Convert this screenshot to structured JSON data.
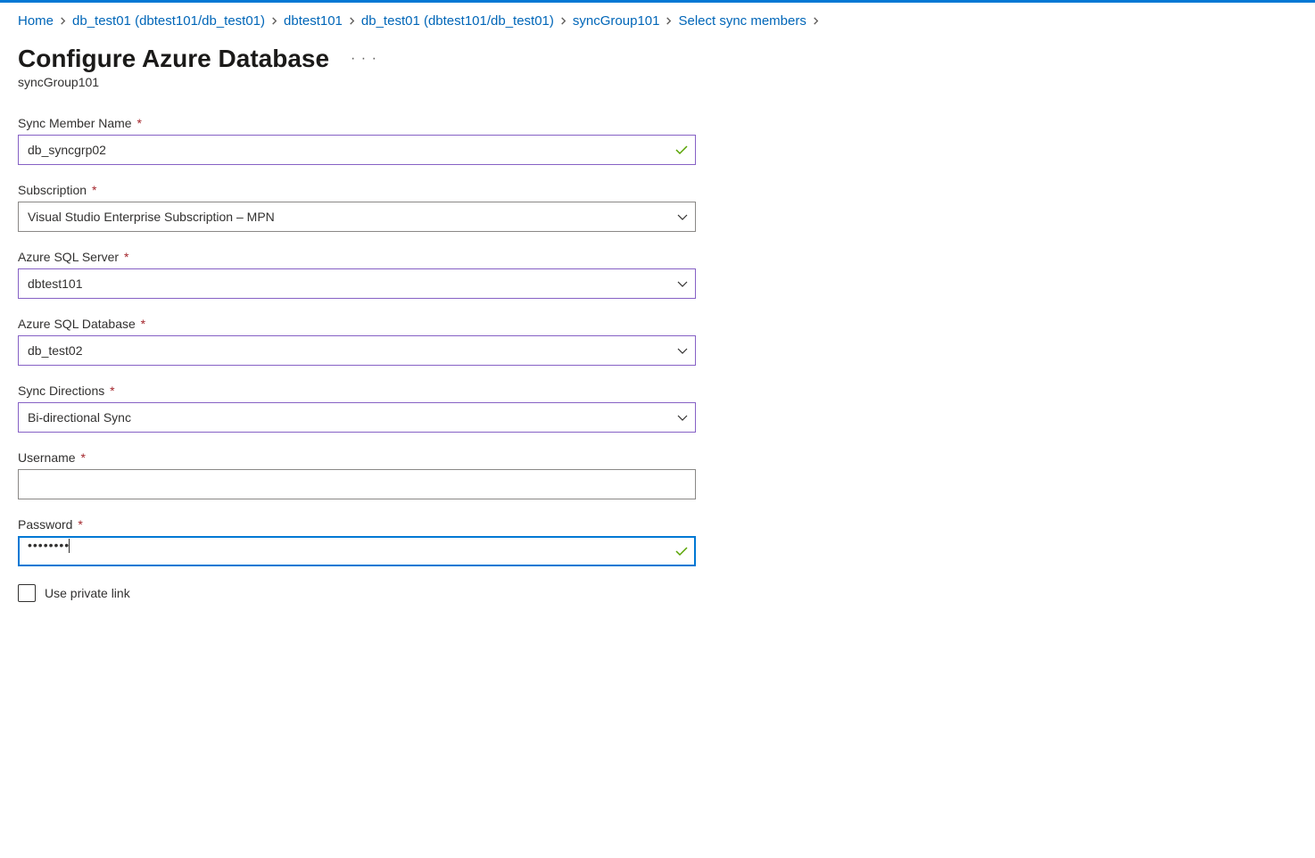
{
  "breadcrumb": {
    "items": [
      "Home",
      "db_test01 (dbtest101/db_test01)",
      "dbtest101",
      "db_test01 (dbtest101/db_test01)",
      "syncGroup101",
      "Select sync members"
    ]
  },
  "header": {
    "title": "Configure Azure Database",
    "subtitle": "syncGroup101"
  },
  "form": {
    "sync_member_name": {
      "label": "Sync Member Name",
      "value": "db_syncgrp02"
    },
    "subscription": {
      "label": "Subscription",
      "value": "Visual Studio Enterprise Subscription – MPN"
    },
    "azure_sql_server": {
      "label": "Azure SQL Server",
      "value": "dbtest101"
    },
    "azure_sql_database": {
      "label": "Azure SQL Database",
      "value": "db_test02"
    },
    "sync_directions": {
      "label": "Sync Directions",
      "value": "Bi-directional Sync"
    },
    "username": {
      "label": "Username",
      "value": ""
    },
    "password": {
      "label": "Password",
      "value": "••••••••"
    },
    "private_link": {
      "label": "Use private link"
    },
    "required_mark": "*"
  }
}
